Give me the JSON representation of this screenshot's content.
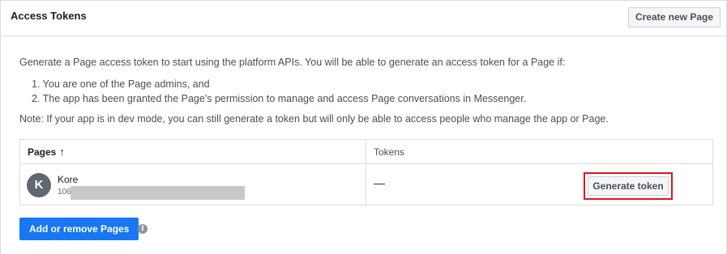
{
  "header": {
    "title": "Access Tokens",
    "create_page_label": "Create new Page"
  },
  "intro": "Generate a Page access token to start using the platform APIs. You will be able to generate an access token for a Page if:",
  "steps": [
    "1. You are one of the Page admins, and",
    "2. The app has been granted the Page's permission to manage and access Page conversations in Messenger."
  ],
  "note": "Note: If your app is in dev mode, you can still generate a token but will only be able to access people who manage the app or Page.",
  "table": {
    "headers": {
      "pages": "Pages",
      "pages_sort_arrow": "↑",
      "tokens": "Tokens"
    },
    "rows": [
      {
        "avatar_letter": "K",
        "page_name": "Kore",
        "page_id_prefix": "106",
        "token": "—",
        "action_label": "Generate token"
      }
    ]
  },
  "footer": {
    "add_remove_label": "Add or remove Pages",
    "info_icon": "info-icon"
  },
  "colors": {
    "primary_button": "#1877f2",
    "highlight_box": "#e0141e"
  }
}
